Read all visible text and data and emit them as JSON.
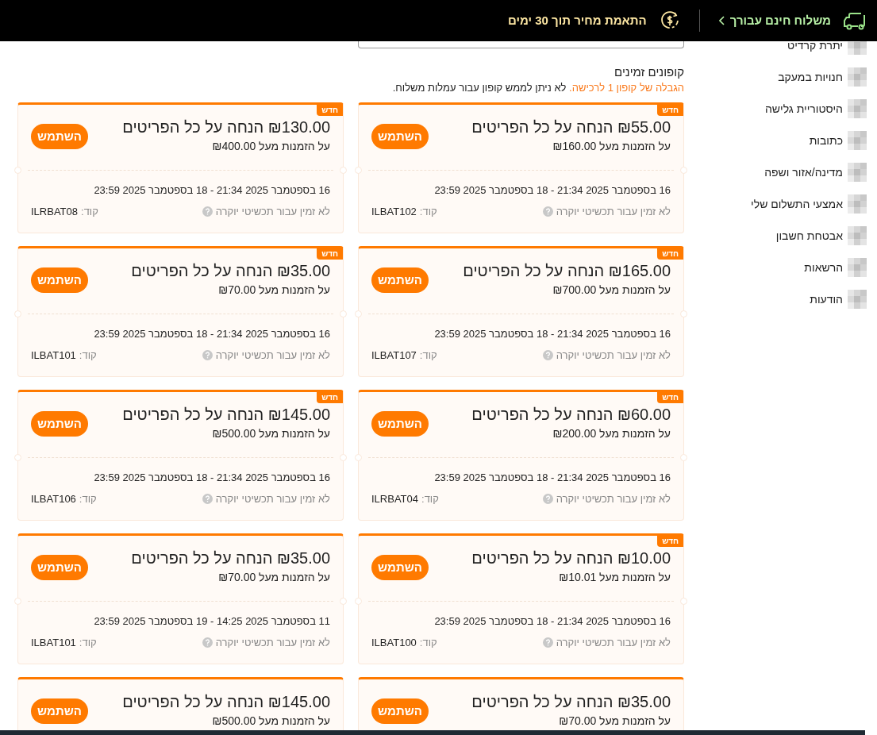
{
  "header": {
    "shipping": "משלוח חינם עבורך",
    "price_match": "התאמת מחיר תוך 30 ימים"
  },
  "sidebar": {
    "items": [
      {
        "label": "יתרת קרדיט"
      },
      {
        "label": "חנויות במעקב"
      },
      {
        "label": "היסטוריית גלישה"
      },
      {
        "label": "כתובות"
      },
      {
        "label": "מדינה/אזור ושפה"
      },
      {
        "label": "אמצעי התשלום שלי"
      },
      {
        "label": "אבטחת חשבון"
      },
      {
        "label": "הרשאות"
      },
      {
        "label": "הודעות"
      }
    ]
  },
  "coupons": {
    "title": "קופונים זמינים",
    "limit_notice": "הגבלה של קופון 1 לרכישה.",
    "fees_notice": "לא ניתן לממש קופון עבור עמלות משלוח.",
    "cards": [
      {
        "is_new": true,
        "badge": "חדש",
        "title": "₪55.00 הנחה על כל הפריטים",
        "condition": "על הזמנות מעל ₪160.00",
        "button": "השתמש",
        "dates": "16 בספטמבר 2025 21:34 - 18 בספטמבר 2025 23:59",
        "note": "לא זמין עבור תכשיטי יוקרה",
        "code_label": "קוד:",
        "code": "ILBAT102"
      },
      {
        "is_new": true,
        "badge": "חדש",
        "title": "₪130.00 הנחה על כל הפריטים",
        "condition": "על הזמנות מעל ₪400.00",
        "button": "השתמש",
        "dates": "16 בספטמבר 2025 21:34 - 18 בספטמבר 2025 23:59",
        "note": "לא זמין עבור תכשיטי יוקרה",
        "code_label": "קוד:",
        "code": "ILRBAT08"
      },
      {
        "is_new": true,
        "badge": "חדש",
        "title": "₪165.00 הנחה על כל הפריטים",
        "condition": "על הזמנות מעל ₪700.00",
        "button": "השתמש",
        "dates": "16 בספטמבר 2025 21:34 - 18 בספטמבר 2025 23:59",
        "note": "לא זמין עבור תכשיטי יוקרה",
        "code_label": "קוד:",
        "code": "ILBAT107"
      },
      {
        "is_new": true,
        "badge": "חדש",
        "title": "₪35.00 הנחה על כל הפריטים",
        "condition": "על הזמנות מעל ₪70.00",
        "button": "השתמש",
        "dates": "16 בספטמבר 2025 21:34 - 18 בספטמבר 2025 23:59",
        "note": "לא זמין עבור תכשיטי יוקרה",
        "code_label": "קוד:",
        "code": "ILBAT101"
      },
      {
        "is_new": true,
        "badge": "חדש",
        "title": "₪60.00 הנחה על כל הפריטים",
        "condition": "על הזמנות מעל ₪200.00",
        "button": "השתמש",
        "dates": "16 בספטמבר 2025 21:34 - 18 בספטמבר 2025 23:59",
        "note": "לא זמין עבור תכשיטי יוקרה",
        "code_label": "קוד:",
        "code": "ILRBAT04"
      },
      {
        "is_new": true,
        "badge": "חדש",
        "title": "₪145.00 הנחה על כל הפריטים",
        "condition": "על הזמנות מעל ₪500.00",
        "button": "השתמש",
        "dates": "16 בספטמבר 2025 21:34 - 18 בספטמבר 2025 23:59",
        "note": "לא זמין עבור תכשיטי יוקרה",
        "code_label": "קוד:",
        "code": "ILBAT106"
      },
      {
        "is_new": true,
        "badge": "חדש",
        "title": "₪10.00 הנחה על כל הפריטים",
        "condition": "על הזמנות מעל ₪10.01",
        "button": "השתמש",
        "dates": "16 בספטמבר 2025 21:34 - 18 בספטמבר 2025 23:59",
        "note": "לא זמין עבור תכשיטי יוקרה",
        "code_label": "קוד:",
        "code": "ILBAT100"
      },
      {
        "is_new": false,
        "title": "₪35.00 הנחה על כל הפריטים",
        "condition": "על הזמנות מעל ₪70.00",
        "button": "השתמש",
        "dates": "11 בספטמבר 2025 14:25 - 19 בספטמבר 2025 23:59",
        "note": "לא זמין עבור תכשיטי יוקרה",
        "code_label": "קוד:",
        "code": "ILBAT101"
      },
      {
        "is_new": false,
        "title": "₪35.00 הנחה על כל הפריטים",
        "condition": "על הזמנות מעל ₪70.00",
        "button": "השתמש"
      },
      {
        "is_new": false,
        "title": "₪145.00 הנחה על כל הפריטים",
        "condition": "על הזמנות מעל ₪500.00",
        "button": "השתמש"
      }
    ]
  }
}
